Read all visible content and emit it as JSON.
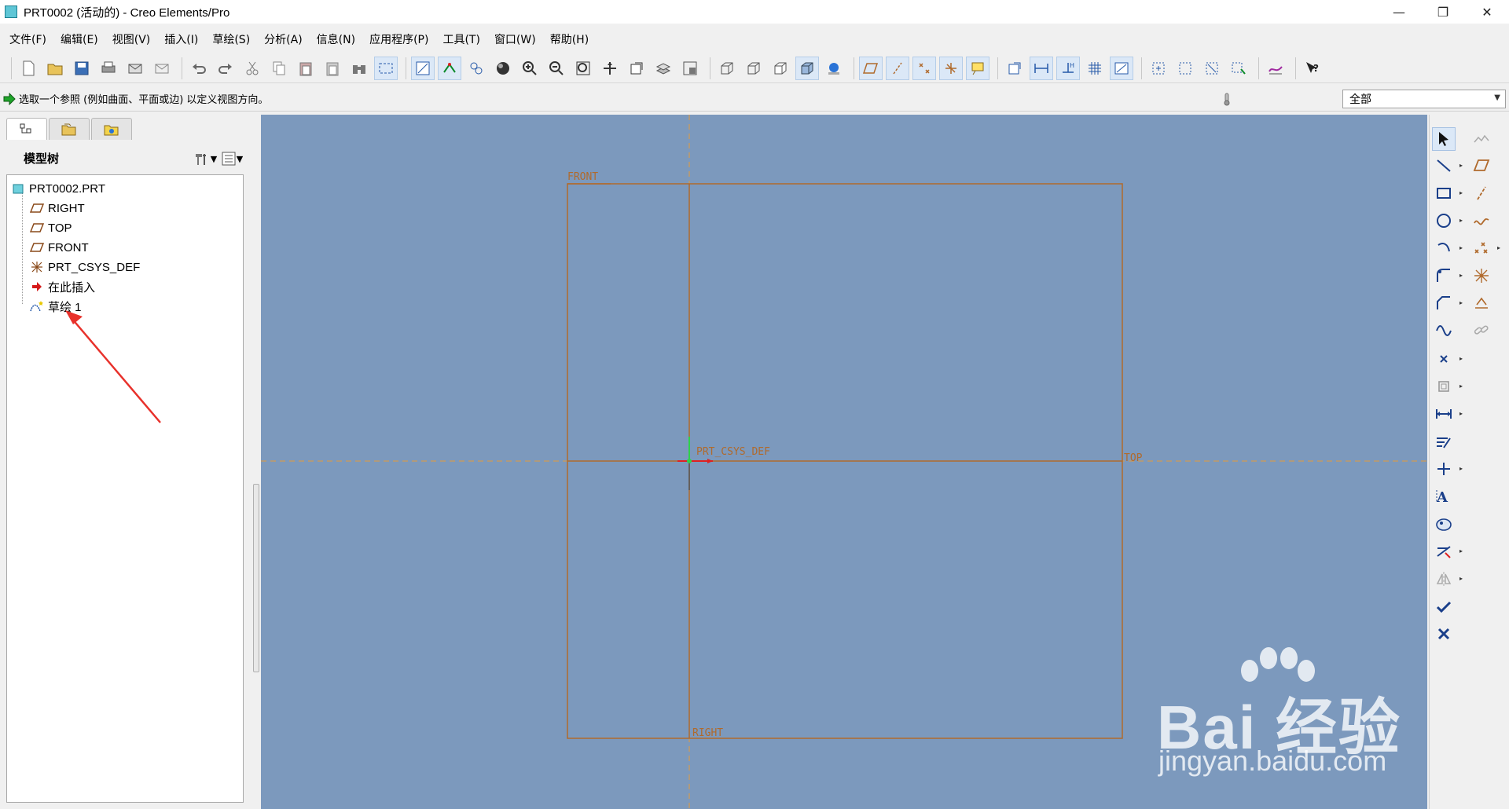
{
  "window": {
    "title": "PRT0002 (活动的) - Creo Elements/Pro",
    "minimize": "—",
    "restore": "❐",
    "close": "✕"
  },
  "menu": [
    "文件(F)",
    "编辑(E)",
    "视图(V)",
    "插入(I)",
    "草绘(S)",
    "分析(A)",
    "信息(N)",
    "应用程序(P)",
    "工具(T)",
    "窗口(W)",
    "帮助(H)"
  ],
  "status": {
    "message": "选取一个参照 (例如曲面、平面或边) 以定义视图方向。",
    "filter_value": "全部"
  },
  "model_tree": {
    "title": "模型树",
    "items": [
      {
        "label": "PRT0002.PRT",
        "icon": "part-icon"
      },
      {
        "label": "RIGHT",
        "icon": "datum-plane-icon"
      },
      {
        "label": "TOP",
        "icon": "datum-plane-icon"
      },
      {
        "label": "FRONT",
        "icon": "datum-plane-icon"
      },
      {
        "label": "PRT_CSYS_DEF",
        "icon": "csys-icon"
      },
      {
        "label": "在此插入",
        "icon": "insert-here-icon"
      },
      {
        "label": "草绘 1",
        "icon": "sketch-icon"
      }
    ]
  },
  "viewport": {
    "labels": {
      "front": "FRONT",
      "top": "TOP",
      "right": "RIGHT",
      "csys": "PRT_CSYS_DEF"
    },
    "colors": {
      "background": "#7c99bd",
      "datum": "#b06a2c",
      "axis_dashed": "#e39a3a"
    }
  },
  "watermark": {
    "brand": "Bai 经验",
    "url": "jingyan.baidu.com"
  },
  "colors": {
    "accent_arrow": "#e8312b"
  }
}
